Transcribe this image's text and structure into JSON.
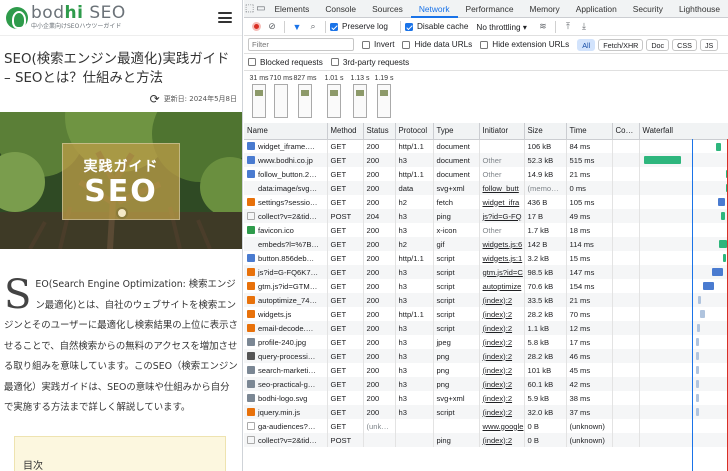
{
  "site": {
    "logo_main": "bodhi SEO",
    "logo_sub": "中小企業向けSEOハウツーガイド",
    "title": "SEO(検索エンジン最適化)実践ガイド – SEOとは？仕組みと方法",
    "updated": "更新日: 2024年5月8日",
    "hero_sub": "実践ガイド",
    "hero_main": "SEO",
    "dropcap": "S",
    "intro": "EO(Search Engine Optimization: 検索エンジン最適化)とは、自社のウェブサイトを検索エンジンとそのユーザーに最適化し検索結果の上位に表示させることで、自然検索からの無料のアクセスを増加させる取り組みを意味しています。このSEO（検索エンジン最適化）実践ガイドは、SEOの意味や仕組みから自分で実施する方法まで詳しく解説しています。",
    "toc": "目次"
  },
  "devtools": {
    "tabs": [
      "Elements",
      "Console",
      "Sources",
      "Network",
      "Performance",
      "Memory",
      "Application",
      "Security",
      "Lighthouse"
    ],
    "active_tab": "Network",
    "toolbar": {
      "preserve_log": "Preserve log",
      "disable_cache": "Disable cache",
      "throttling": "No throttling"
    },
    "filter": {
      "placeholder": "Filter",
      "invert": "Invert",
      "hide_data_urls": "Hide data URLs",
      "hide_extension_urls": "Hide extension URLs",
      "types": [
        "All",
        "Fetch/XHR",
        "Doc",
        "CSS",
        "JS"
      ]
    },
    "blocked_requests": "Blocked requests",
    "third_party_requests": "3rd-party requests",
    "frames": [
      "31 ms",
      "710 ms",
      "827 ms",
      "1.01 s",
      "1.13 s",
      "1.19 s"
    ],
    "columns": [
      "Name",
      "Method",
      "Status",
      "Protocol",
      "Type",
      "Initiator",
      "Size",
      "Time",
      "Co…",
      "Waterfall"
    ],
    "rows": [
      {
        "name": "widget_iframe.…",
        "method": "GET",
        "status": "200",
        "protocol": "http/1.1",
        "type": "document",
        "initiator": "",
        "size": "106 kB",
        "time": "84 ms",
        "icon": "doc",
        "wf_start": 1.03,
        "wf_len": 0.06
      },
      {
        "name": "www.bodhi.co.jp",
        "method": "GET",
        "status": "200",
        "protocol": "h3",
        "type": "document",
        "initiator": "Other",
        "size": "52.3 kB",
        "time": "515 ms",
        "icon": "doc",
        "wf_start": 0.02,
        "wf_len": 0.515
      },
      {
        "name": "follow_button.2…",
        "method": "GET",
        "status": "200",
        "protocol": "http/1.1",
        "type": "document",
        "initiator": "Other",
        "size": "14.9 kB",
        "time": "21 ms",
        "icon": "doc",
        "wf_start": 1.16,
        "wf_len": 0.021
      },
      {
        "name": "data:image/svg…",
        "method": "GET",
        "status": "200",
        "protocol": "data",
        "type": "svg+xml",
        "initiator": "follow_butt",
        "size": "(memo…",
        "time": "0 ms",
        "icon": "none",
        "wf_start": 1.17,
        "wf_len": 0.005
      },
      {
        "name": "settings?sessio…",
        "method": "GET",
        "status": "200",
        "protocol": "h2",
        "type": "fetch",
        "initiator": "widget_ifra",
        "size": "436 B",
        "time": "105 ms",
        "icon": "code",
        "wf_start": 1.05,
        "wf_len": 0.105
      },
      {
        "name": "collect?v=2&tid…",
        "method": "POST",
        "status": "204",
        "protocol": "h3",
        "type": "ping",
        "initiator": "js?id=G-FQ",
        "size": "17 B",
        "time": "49 ms",
        "icon": "blank",
        "wf_start": 1.1,
        "wf_len": 0.049
      },
      {
        "name": "favicon.ico",
        "method": "GET",
        "status": "200",
        "protocol": "h3",
        "type": "x-icon",
        "initiator": "Other",
        "size": "1.7 kB",
        "time": "18 ms",
        "icon": "fav",
        "wf_start": 1.18,
        "wf_len": 0.018
      },
      {
        "name": "embeds?l=%7B…",
        "method": "GET",
        "status": "200",
        "protocol": "h2",
        "type": "gif",
        "initiator": "widgets.js:6",
        "size": "142 B",
        "time": "114 ms",
        "icon": "none",
        "wf_start": 1.07,
        "wf_len": 0.114
      },
      {
        "name": "button.856deb…",
        "method": "GET",
        "status": "200",
        "protocol": "http/1.1",
        "type": "script",
        "initiator": "widgets.js:1",
        "size": "3.2 kB",
        "time": "15 ms",
        "icon": "doc",
        "wf_start": 1.13,
        "wf_len": 0.015
      },
      {
        "name": "js?id=G-FQ6K7…",
        "method": "GET",
        "status": "200",
        "protocol": "h3",
        "type": "script",
        "initiator": "gtm.js?id=C",
        "size": "98.5 kB",
        "time": "147 ms",
        "icon": "code",
        "wf_start": 0.97,
        "wf_len": 0.147
      },
      {
        "name": "gtm.js?id=GTM…",
        "method": "GET",
        "status": "200",
        "protocol": "h3",
        "type": "script",
        "initiator": "autoptimize",
        "size": "70.6 kB",
        "time": "154 ms",
        "icon": "code",
        "wf_start": 0.85,
        "wf_len": 0.154
      },
      {
        "name": "autoptimize_74…",
        "method": "GET",
        "status": "200",
        "protocol": "h3",
        "type": "script",
        "initiator": "(index):2",
        "size": "33.5 kB",
        "time": "21 ms",
        "icon": "code",
        "wf_start": 0.78,
        "wf_len": 0.021
      },
      {
        "name": "widgets.js",
        "method": "GET",
        "status": "200",
        "protocol": "http/1.1",
        "type": "script",
        "initiator": "(index):2",
        "size": "28.2 kB",
        "time": "70 ms",
        "icon": "code",
        "wf_start": 0.8,
        "wf_len": 0.07
      },
      {
        "name": "email-decode.…",
        "method": "GET",
        "status": "200",
        "protocol": "h3",
        "type": "script",
        "initiator": "(index):2",
        "size": "1.1 kB",
        "time": "12 ms",
        "icon": "code",
        "wf_start": 0.76,
        "wf_len": 0.012
      },
      {
        "name": "profile-240.jpg",
        "method": "GET",
        "status": "200",
        "protocol": "h3",
        "type": "jpeg",
        "initiator": "(index):2",
        "size": "5.8 kB",
        "time": "17 ms",
        "icon": "img",
        "wf_start": 0.74,
        "wf_len": 0.017
      },
      {
        "name": "query-processi…",
        "method": "GET",
        "status": "200",
        "protocol": "h3",
        "type": "png",
        "initiator": "(index):2",
        "size": "28.2 kB",
        "time": "46 ms",
        "icon": "dash",
        "wf_start": 0.74,
        "wf_len": 0.046
      },
      {
        "name": "search-marketi…",
        "method": "GET",
        "status": "200",
        "protocol": "h3",
        "type": "png",
        "initiator": "(index):2",
        "size": "101 kB",
        "time": "45 ms",
        "icon": "img",
        "wf_start": 0.74,
        "wf_len": 0.045
      },
      {
        "name": "seo-practical-g…",
        "method": "GET",
        "status": "200",
        "protocol": "h3",
        "type": "png",
        "initiator": "(index):2",
        "size": "60.1 kB",
        "time": "42 ms",
        "icon": "img",
        "wf_start": 0.74,
        "wf_len": 0.042
      },
      {
        "name": "bodhi-logo.svg",
        "method": "GET",
        "status": "200",
        "protocol": "h3",
        "type": "svg+xml",
        "initiator": "(index):2",
        "size": "5.9 kB",
        "time": "38 ms",
        "icon": "img",
        "wf_start": 0.74,
        "wf_len": 0.038
      },
      {
        "name": "jquery.min.js",
        "method": "GET",
        "status": "200",
        "protocol": "h3",
        "type": "script",
        "initiator": "(index):2",
        "size": "32.0 kB",
        "time": "37 ms",
        "icon": "code",
        "wf_start": 0.74,
        "wf_len": 0.037
      },
      {
        "name": "ga-audiences?…",
        "method": "GET",
        "status": "(unk…",
        "protocol": "",
        "type": "",
        "initiator": "www.google",
        "size": "0 B",
        "time": "(unknown)",
        "icon": "blank",
        "wf_start": -1,
        "wf_len": 0
      },
      {
        "name": "collect?v=2&tid…",
        "method": "POST",
        "status": "",
        "protocol": "",
        "type": "ping",
        "initiator": "(index):2",
        "size": "0 B",
        "time": "(unknown)",
        "icon": "blank",
        "wf_start": -1,
        "wf_len": 0
      }
    ],
    "colors": {
      "accent": "#1a73e8",
      "waterfall_bar": "#2eb67d",
      "dom_line": "#1a73e8",
      "load_line": "#d93025"
    }
  }
}
